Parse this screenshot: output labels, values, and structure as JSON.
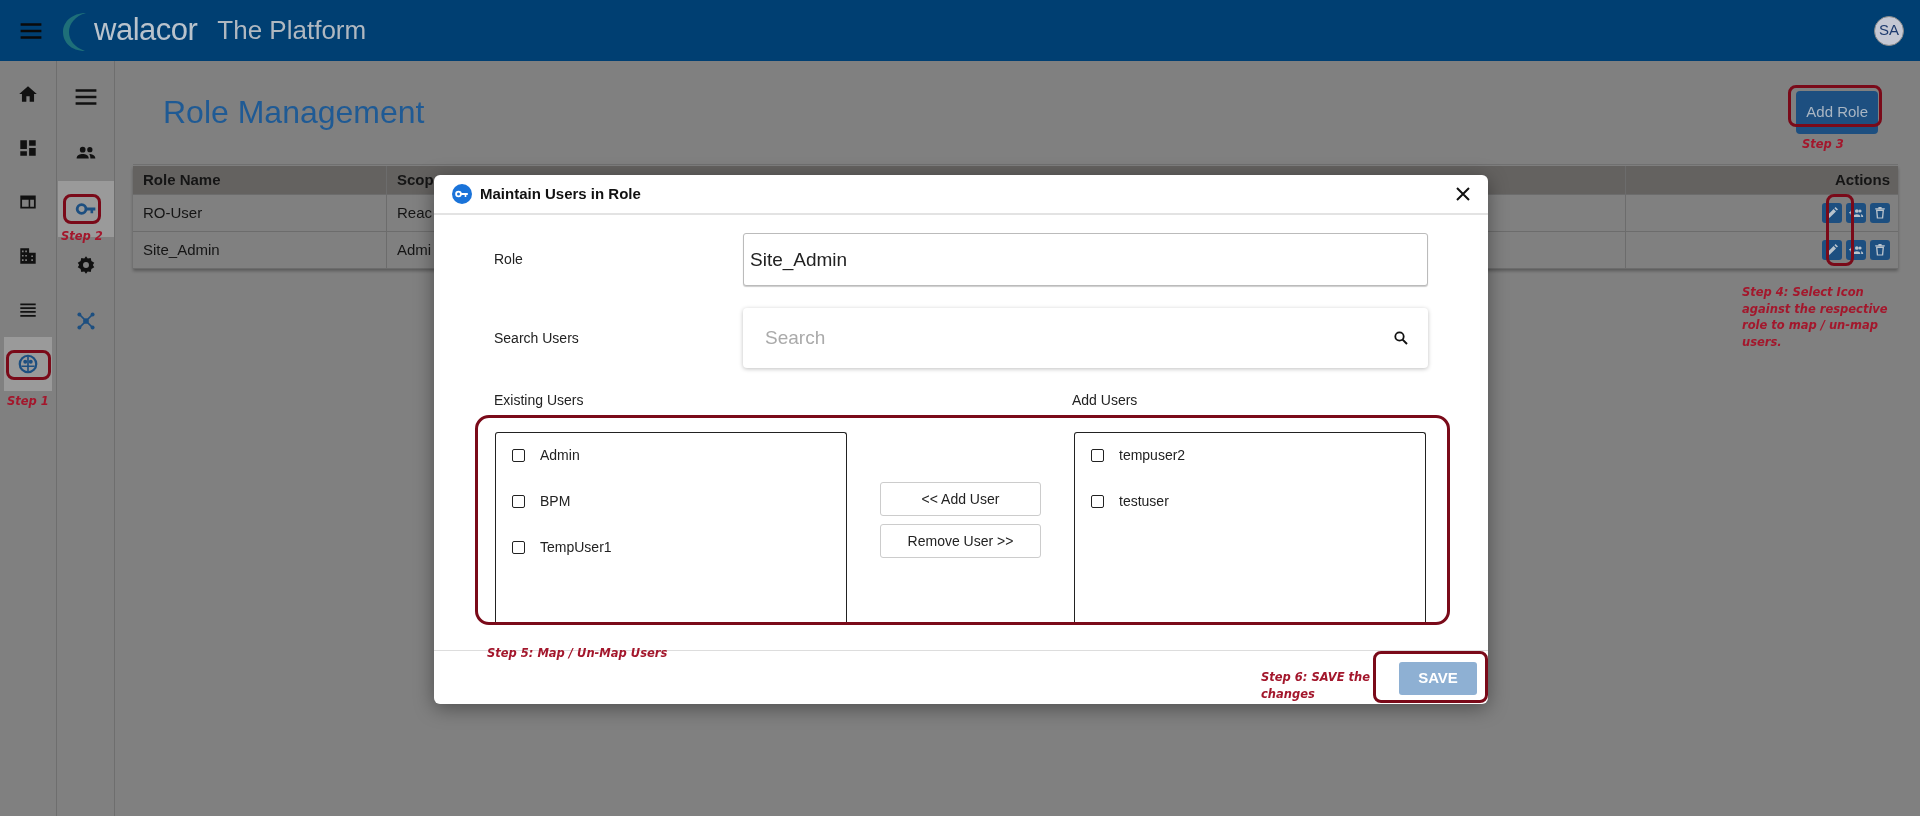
{
  "header": {
    "logo": "walacor",
    "title": "The Platform",
    "avatar": "SA"
  },
  "rail": [
    {
      "selected": false
    },
    {
      "selected": false
    },
    {
      "selected": false
    },
    {
      "selected": false
    },
    {
      "selected": false
    },
    {
      "selected": true
    }
  ],
  "subnav": [
    {
      "selected": false
    },
    {
      "selected": false
    },
    {
      "selected": true
    },
    {
      "selected": false
    },
    {
      "selected": false
    }
  ],
  "page": {
    "title": "Role Management",
    "add_button": "Add Role"
  },
  "table": {
    "columns": [
      "Role Name",
      "Scop",
      "Actions"
    ],
    "rows": [
      {
        "cells": [
          "RO-User",
          "Reac"
        ]
      },
      {
        "cells": [
          "Site_Admin",
          "Admi"
        ]
      }
    ]
  },
  "dialog": {
    "title": "Maintain Users in Role",
    "role_label": "Role",
    "role_value": "Site_Admin",
    "search_label": "Search Users",
    "search_placeholder": "Search",
    "existing_label": "Existing Users",
    "existing_users": [
      {
        "name": "Admin",
        "checked": false
      },
      {
        "name": "BPM",
        "checked": false
      },
      {
        "name": "TempUser1",
        "checked": false
      }
    ],
    "add_label": "Add Users",
    "add_users": [
      {
        "name": "tempuser2",
        "checked": false
      },
      {
        "name": "testuser",
        "checked": false
      }
    ],
    "buttons": [
      "<< Add User",
      "Remove User >>"
    ],
    "save": {
      "label": "SAVE",
      "disabled": true
    }
  },
  "annotations": [
    {
      "text": "Step 1"
    },
    {
      "text": "Step 2"
    },
    {
      "text": "Step 3"
    },
    {
      "text": "Step 4: Select Icon against the respective role to map / un-map users."
    },
    {
      "text": "Step 5: Map / Un-Map Users"
    },
    {
      "text": "Step 6: SAVE the changes"
    }
  ]
}
